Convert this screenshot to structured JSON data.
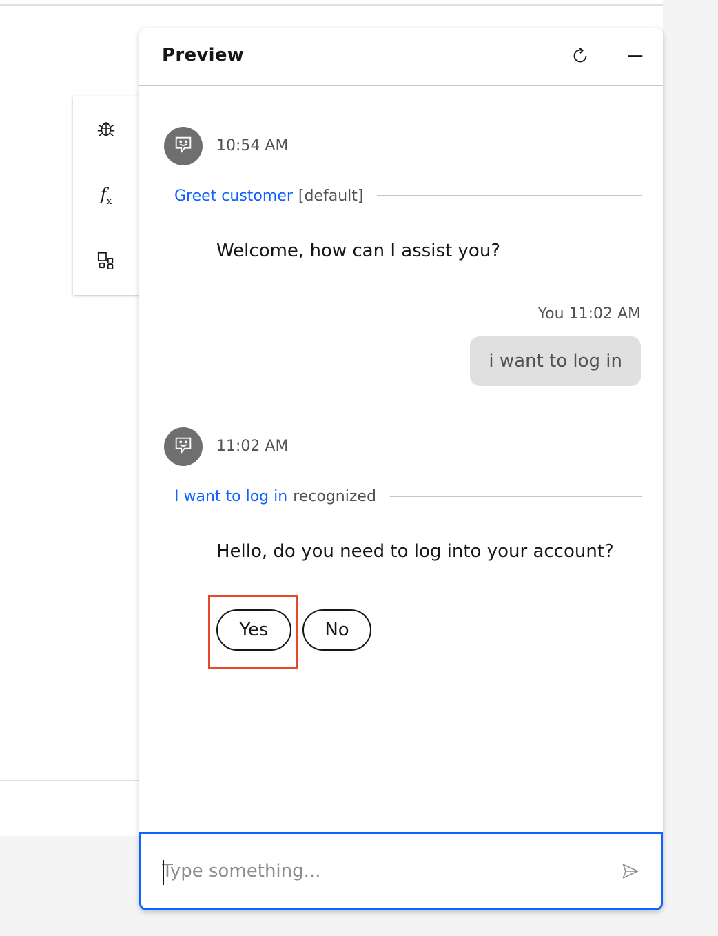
{
  "panel": {
    "title": "Preview",
    "refresh_icon": "refresh-icon",
    "minimize_icon": "minimize-icon"
  },
  "toolbar": {
    "items": [
      {
        "icon": "debug-icon"
      },
      {
        "icon": "function-icon"
      },
      {
        "icon": "extensions-icon"
      }
    ]
  },
  "conversation": {
    "messages": [
      {
        "type": "bot",
        "time": "10:54 AM",
        "intent_link": "Greet customer",
        "intent_tail": "[default]",
        "text": "Welcome, how can I assist you?"
      },
      {
        "type": "user",
        "meta": "You 11:02 AM",
        "text": "i want to log in"
      },
      {
        "type": "bot",
        "time": "11:02 AM",
        "intent_link": "I want to log in",
        "intent_tail": "recognized",
        "text": "Hello, do you need to log into your account?",
        "options": [
          "Yes",
          "No"
        ]
      }
    ]
  },
  "input": {
    "placeholder": "Type something...",
    "value": ""
  },
  "colors": {
    "accent": "#0f62fe",
    "highlight": "#e5492b",
    "avatar": "#6f6f6f",
    "bubble": "#e0e0e0"
  }
}
